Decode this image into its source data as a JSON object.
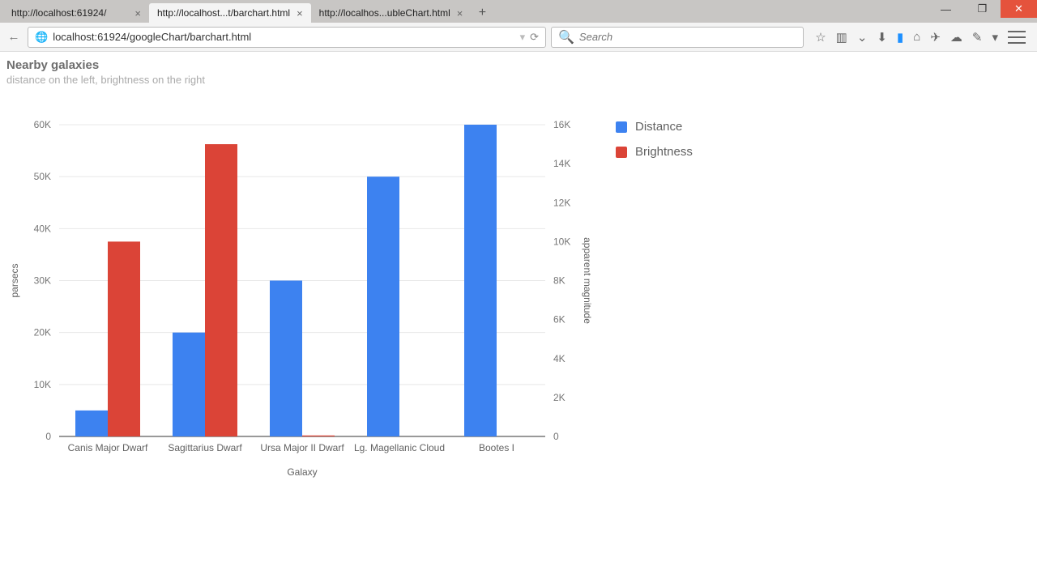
{
  "browser": {
    "tabs": [
      {
        "title": "http://localhost:61924/",
        "active": false
      },
      {
        "title": "http://localhost...t/barchart.html",
        "active": true
      },
      {
        "title": "http://localhos...ubleChart.html",
        "active": false
      }
    ],
    "url": "localhost:61924/googleChart/barchart.html",
    "search_placeholder": "Search"
  },
  "page": {
    "title": "Nearby galaxies",
    "subtitle": "distance on the left, brightness on the right"
  },
  "legend": {
    "distance": "Distance",
    "brightness": "Brightness"
  },
  "chart_data": {
    "type": "bar",
    "title": "Nearby galaxies",
    "subtitle": "distance on the left, brightness on the right",
    "xlabel": "Galaxy",
    "categories": [
      "Canis Major Dwarf",
      "Sagittarius Dwarf",
      "Ursa Major II Dwarf",
      "Lg. Magellanic Cloud",
      "Bootes I"
    ],
    "series": [
      {
        "name": "Distance",
        "axis": "left",
        "values": [
          5000,
          20000,
          30000,
          50000,
          60000
        ],
        "color": "#3d82f0"
      },
      {
        "name": "Brightness",
        "axis": "right",
        "values": [
          10000,
          15000,
          50,
          0,
          0
        ],
        "color": "#db4437"
      }
    ],
    "axes": {
      "left": {
        "label": "parsecs",
        "min": 0,
        "max": 60000,
        "ticks": [
          0,
          10000,
          20000,
          30000,
          40000,
          50000,
          60000
        ],
        "tickLabels": [
          "0",
          "10K",
          "20K",
          "30K",
          "40K",
          "50K",
          "60K"
        ]
      },
      "right": {
        "label": "apparent magnitude",
        "min": 0,
        "max": 16000,
        "ticks": [
          0,
          2000,
          4000,
          6000,
          8000,
          10000,
          12000,
          14000,
          16000
        ],
        "tickLabels": [
          "0",
          "2K",
          "4K",
          "6K",
          "8K",
          "10K",
          "12K",
          "14K",
          "16K"
        ]
      }
    },
    "colors": {
      "distance": "#3d82f0",
      "brightness": "#db4437"
    }
  }
}
